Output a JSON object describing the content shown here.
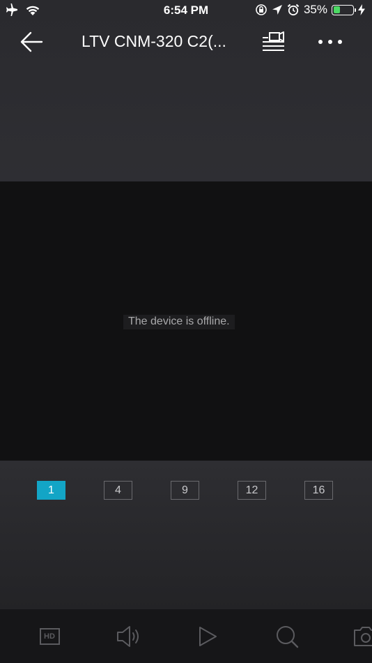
{
  "status_bar": {
    "time": "6:54 PM",
    "battery_percent": "35%",
    "battery_level": 0.35,
    "battery_color": "#4cd964"
  },
  "header": {
    "title": "LTV CNM-320 C2(...",
    "back_icon": "arrow-left-icon",
    "layout_icon": "window-list-icon",
    "more_icon": "more-dots-icon"
  },
  "video": {
    "message": "The device is offline."
  },
  "split": {
    "accent_color": "#13a5c6",
    "options": [
      {
        "label": "1",
        "active": true
      },
      {
        "label": "4",
        "active": false
      },
      {
        "label": "9",
        "active": false
      },
      {
        "label": "12",
        "active": false
      },
      {
        "label": "16",
        "active": false
      }
    ]
  },
  "toolbar": {
    "hd_label": "HD",
    "items": [
      "hd-icon",
      "speaker-icon",
      "play-icon",
      "zoom-icon",
      "camera-icon"
    ]
  }
}
